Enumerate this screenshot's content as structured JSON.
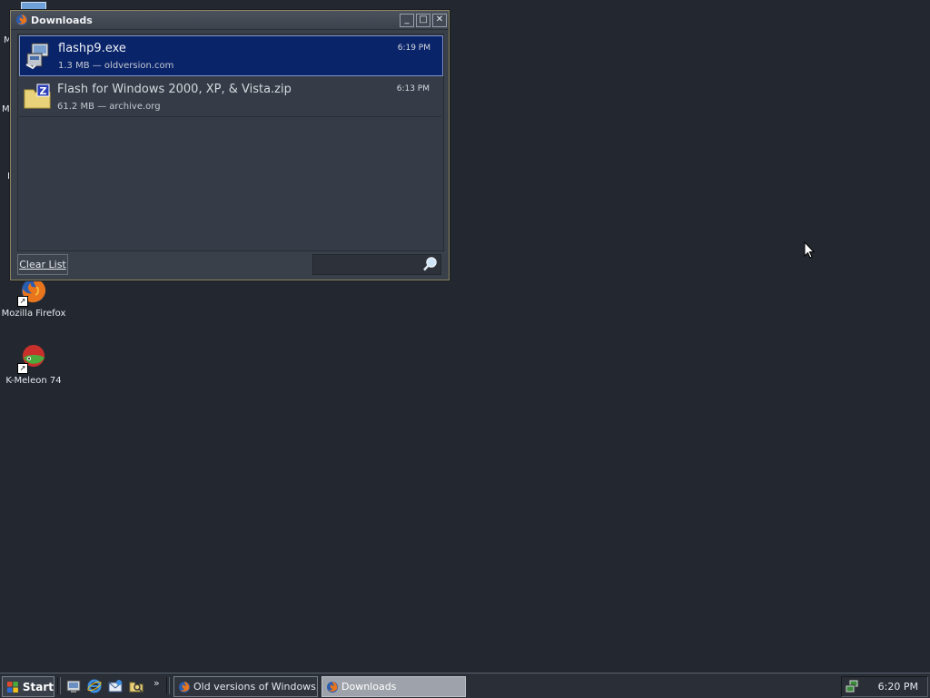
{
  "desktop": {
    "icons": [
      {
        "label": "Mozilla Firefox",
        "icon": "firefox-icon"
      },
      {
        "label": "K-Meleon 74",
        "icon": "k-meleon-icon"
      }
    ],
    "partial_labels": [
      "M",
      "M",
      "I"
    ]
  },
  "window": {
    "title": "Downloads",
    "downloads": [
      {
        "name": "flashp9.exe",
        "meta": "1.3 MB — oldversion.com",
        "time": "6:19 PM",
        "selected": true,
        "icon": "installer-icon"
      },
      {
        "name": "Flash for Windows 2000, XP, & Vista.zip",
        "meta": "61.2 MB — archive.org",
        "time": "6:13 PM",
        "selected": false,
        "icon": "zip-folder-icon"
      }
    ],
    "clear_button": "Clear List",
    "search": {
      "placeholder": "",
      "value": ""
    }
  },
  "taskbar": {
    "start_label": "Start",
    "quick_launch": [
      "show-desktop-icon",
      "internet-explorer-icon",
      "outlook-express-icon",
      "explorer-icon"
    ],
    "chevron": "»",
    "tasks": [
      {
        "label": "Old versions of Windows,...",
        "active": false
      },
      {
        "label": "Downloads",
        "active": true
      }
    ],
    "clock": "6:20 PM"
  },
  "colors": {
    "desktop": "#232830",
    "selection": "#0a246a",
    "window_border": "#8a8460"
  }
}
